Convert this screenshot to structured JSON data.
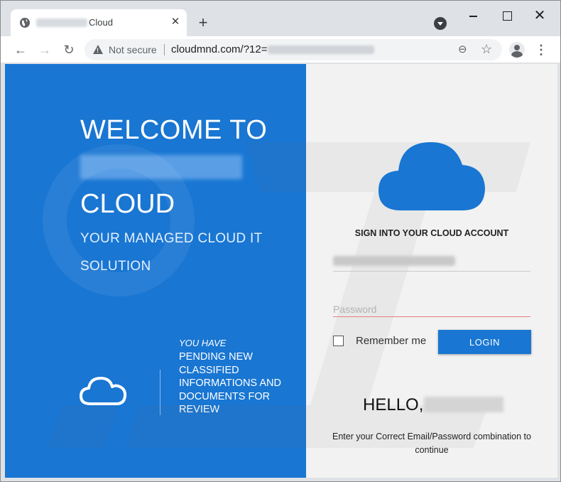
{
  "browser": {
    "tab": {
      "title": "Cloud",
      "favicon": "globe-icon"
    },
    "new_tab_symbol": "+",
    "window_controls": {
      "minimize": "",
      "maximize": "",
      "close": "✕"
    },
    "nav": {
      "back": "←",
      "forward": "→",
      "reload": "↻"
    },
    "address": {
      "security_label": "Not secure",
      "url": "cloudmnd.com/?12="
    },
    "icons": {
      "zoom": "⊖",
      "star": "☆",
      "menu": "⋮"
    }
  },
  "left_panel": {
    "bg_color": "#1976d2",
    "welcome": "WELCOME TO",
    "cloud_word": "CLOUD",
    "tagline": "YOUR MANAGED CLOUD IT SOLUTION",
    "notice_lead": "YOU HAVE",
    "notice_body": "PENDING NEW CLASSIFIED INFORMATIONS AND DOCUMENTS FOR REVIEW"
  },
  "login_panel": {
    "heading": "SIGN INTO YOUR CLOUD ACCOUNT",
    "password_placeholder": "Password",
    "remember_label": "Remember me",
    "login_button": "LOGIN",
    "greeting": "HELLO,",
    "hint": "Enter your Correct Email/Password combination to continue",
    "accent_color": "#1976d2"
  }
}
